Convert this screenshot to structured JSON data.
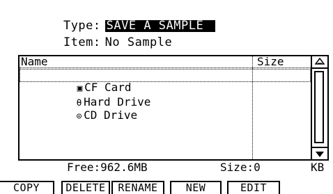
{
  "header": {
    "type_label": "Type:",
    "type_value": "SAVE A SAMPLE",
    "item_label": "Item:",
    "item_value": "No Sample"
  },
  "browser": {
    "columns": {
      "name": "Name",
      "size": "Size"
    },
    "rows": [
      {
        "icon": "cf-card-icon",
        "glyph": "▣",
        "label": "CF Card",
        "selected": true
      },
      {
        "icon": "hard-drive-icon",
        "glyph": "θ",
        "label": "Hard Drive",
        "selected": false
      },
      {
        "icon": "cd-drive-icon",
        "glyph": "⊙",
        "label": "CD Drive",
        "selected": false
      }
    ]
  },
  "footer": {
    "free_label": "Free:962.6MB",
    "size_label": "Size:0",
    "unit": "KB"
  },
  "softkeys": {
    "copy": "COPY",
    "delete": "DELETE",
    "rename": "RENAME",
    "new": "NEW",
    "edit": "EDIT"
  }
}
